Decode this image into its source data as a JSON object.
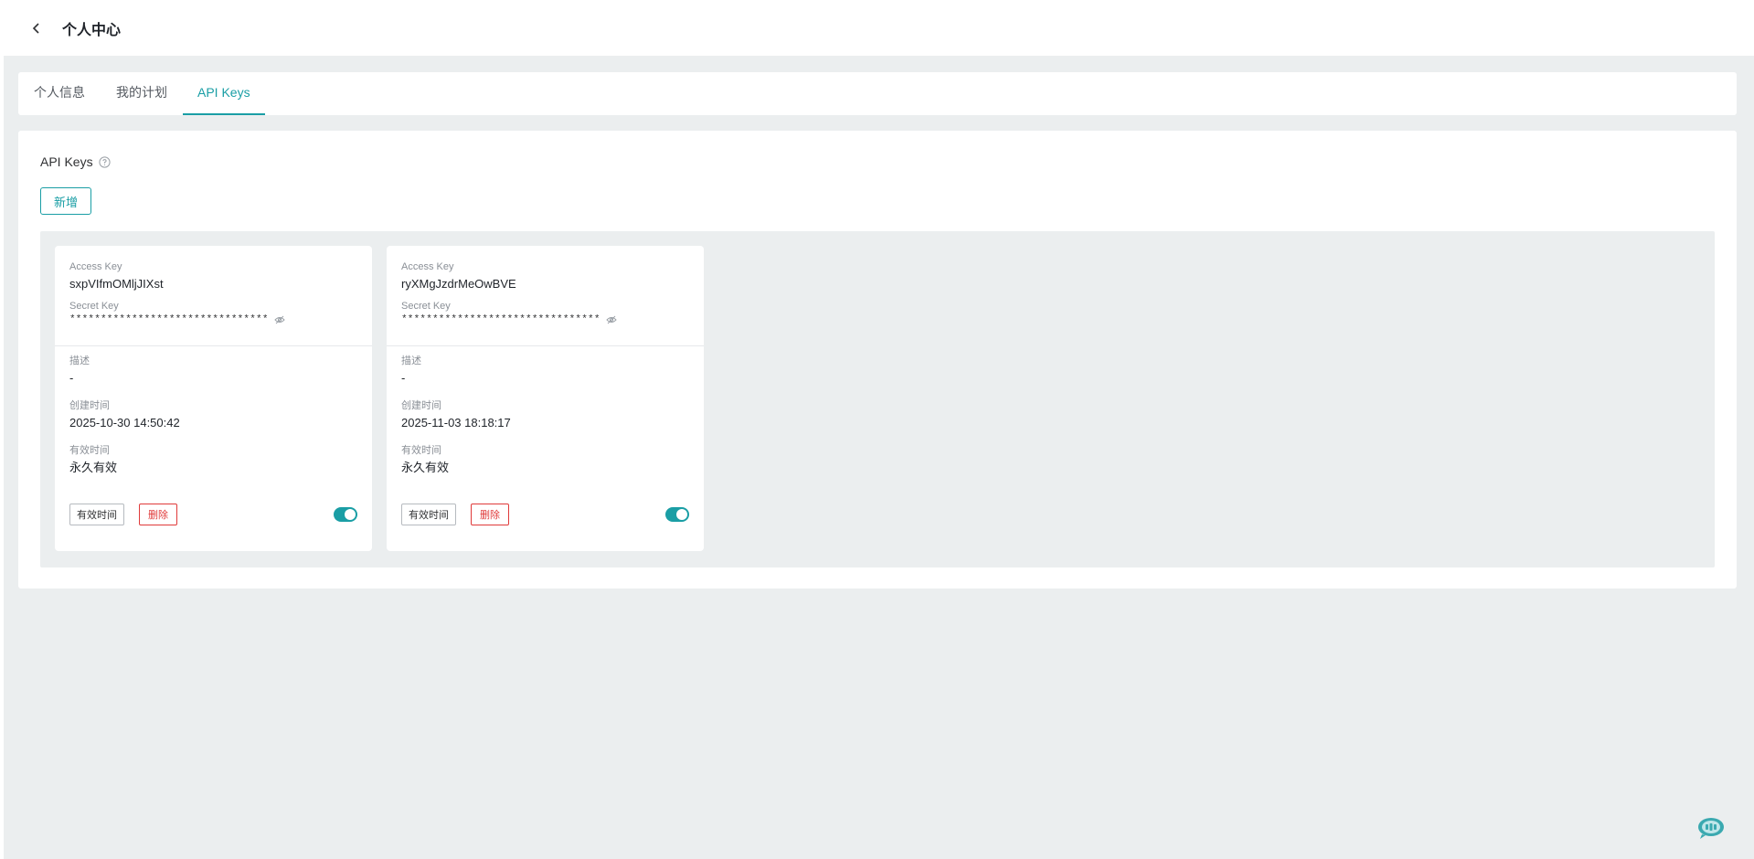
{
  "header": {
    "title": "个人中心"
  },
  "tabs": [
    {
      "label": "个人信息",
      "active": false
    },
    {
      "label": "我的计划",
      "active": false
    },
    {
      "label": "API Keys",
      "active": true
    }
  ],
  "section": {
    "title": "API Keys",
    "add_label": "新增"
  },
  "cards": [
    {
      "access_key_label": "Access Key",
      "access_key": "sxpVIfmOMljJIXst",
      "secret_key_label": "Secret Key",
      "secret_key": "********************************",
      "desc_label": "描述",
      "desc": "-",
      "created_label": "创建时间",
      "created": "2025-10-30 14:50:42",
      "valid_label": "有效时间",
      "valid": "永久有效",
      "valid_button": "有效时间",
      "delete_button": "删除",
      "enabled": true
    },
    {
      "access_key_label": "Access Key",
      "access_key": "ryXMgJzdrMeOwBVE",
      "secret_key_label": "Secret Key",
      "secret_key": "********************************",
      "desc_label": "描述",
      "desc": "-",
      "created_label": "创建时间",
      "created": "2025-11-03 18:18:17",
      "valid_label": "有效时间",
      "valid": "永久有效",
      "valid_button": "有效时间",
      "delete_button": "删除",
      "enabled": true
    }
  ],
  "colors": {
    "accent": "#1a9ea5",
    "danger": "#e03a3a",
    "background": "#ebeeef"
  },
  "icons": {
    "back": "chevron-left-icon",
    "help": "question-circle-icon",
    "eye": "eye-hidden-icon",
    "widget": "chat-assistant-icon"
  }
}
